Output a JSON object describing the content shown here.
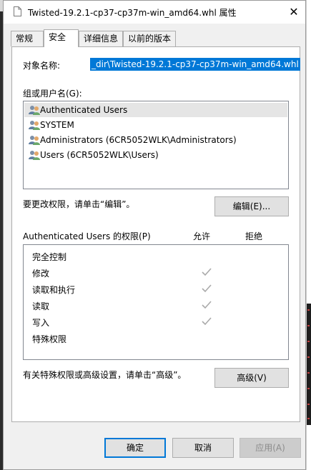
{
  "window": {
    "title": "Twisted-19.2.1-cp37-cp37m-win_amd64.whl 属性",
    "close_glyph": "✕"
  },
  "tabs": [
    {
      "label": "常规",
      "active": false
    },
    {
      "label": "安全",
      "active": true
    },
    {
      "label": "详细信息",
      "active": false
    },
    {
      "label": "以前的版本",
      "active": false
    }
  ],
  "security": {
    "object_name_label": "对象名称:",
    "object_name_value": "_dir\\Twisted-19.2.1-cp37-cp37m-win_amd64.whl",
    "group_label": "组或用户名(G):",
    "users": [
      {
        "name": "Authenticated Users",
        "selected": true
      },
      {
        "name": "SYSTEM",
        "selected": false
      },
      {
        "name": "Administrators (6CR5052WLK\\Administrators)",
        "selected": false
      },
      {
        "name": "Users (6CR5052WLK\\Users)",
        "selected": false
      }
    ],
    "change_perm_text": "要更改权限，请单击“编辑”。",
    "edit_button": "编辑(E)...",
    "perm_header": "Authenticated Users 的权限(P)",
    "allow_header": "允许",
    "deny_header": "拒绝",
    "permissions": [
      {
        "name": "完全控制",
        "allow": false,
        "deny": false
      },
      {
        "name": "修改",
        "allow": true,
        "deny": false
      },
      {
        "name": "读取和执行",
        "allow": true,
        "deny": false
      },
      {
        "name": "读取",
        "allow": true,
        "deny": false
      },
      {
        "name": "写入",
        "allow": true,
        "deny": false
      },
      {
        "name": "特殊权限",
        "allow": false,
        "deny": false
      }
    ],
    "advanced_text": "有关特殊权限或高级设置，请单击“高级”。",
    "advanced_button": "高级(V)"
  },
  "footer": {
    "ok": "确定",
    "cancel": "取消",
    "apply": "应用(A)"
  },
  "colors": {
    "selection": "#0078d7",
    "check": "#aaaaaa"
  }
}
